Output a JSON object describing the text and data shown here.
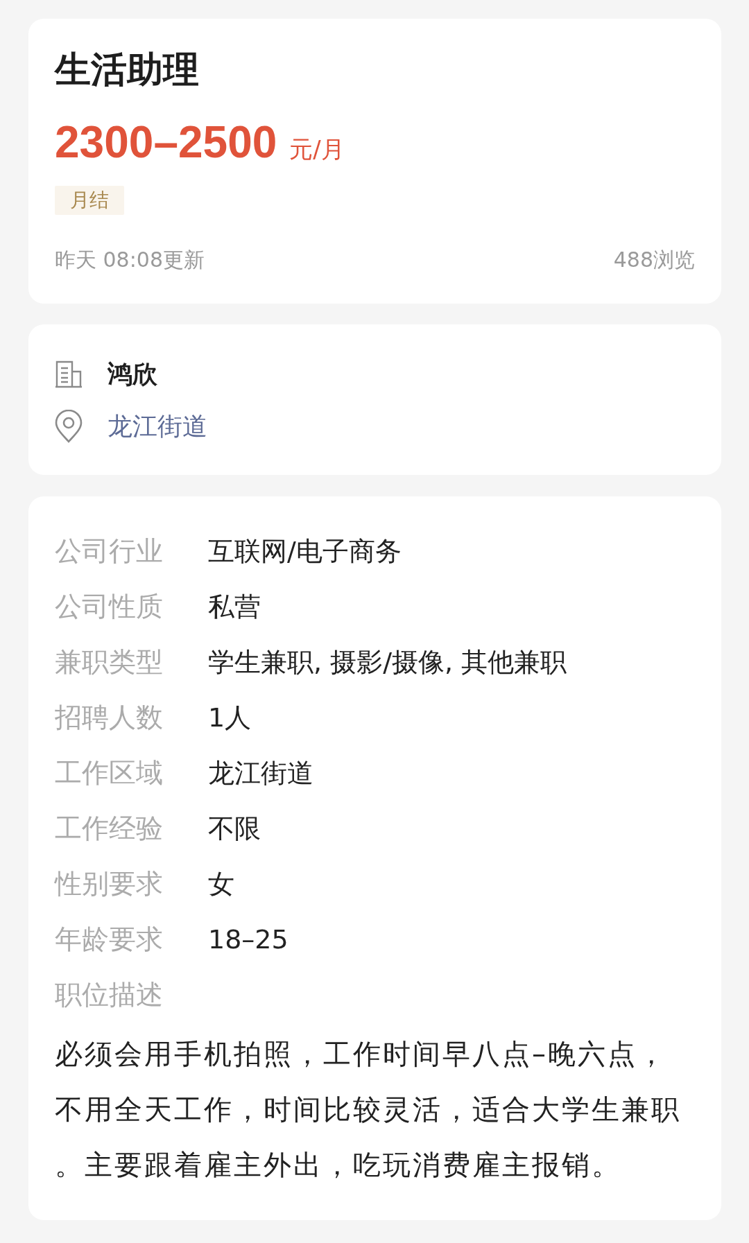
{
  "job": {
    "title": "生活助理",
    "salary": {
      "range": "2300–2500",
      "unit": "元/月"
    },
    "tags": [
      "月结"
    ],
    "updated": "昨天 08:08更新",
    "views": "488浏览"
  },
  "company": {
    "name": "鸿欣",
    "location": "龙江街道"
  },
  "details": [
    {
      "label": "公司行业",
      "value": "互联网/电子商务"
    },
    {
      "label": "公司性质",
      "value": "私营"
    },
    {
      "label": "兼职类型",
      "value": "学生兼职, 摄影/摄像, 其他兼职"
    },
    {
      "label": "招聘人数",
      "value": "1人"
    },
    {
      "label": "工作区域",
      "value": "龙江街道"
    },
    {
      "label": "工作经验",
      "value": "不限"
    },
    {
      "label": "性别要求",
      "value": "女"
    },
    {
      "label": "年龄要求",
      "value": "18–25"
    }
  ],
  "description": {
    "label": "职位描述",
    "text": "必须会用手机拍照，工作时间早八点–晚六点，不用全天工作，时间比较灵活，适合大学生兼职。主要跟着雇主外出，吃玩消费雇主报销。"
  }
}
